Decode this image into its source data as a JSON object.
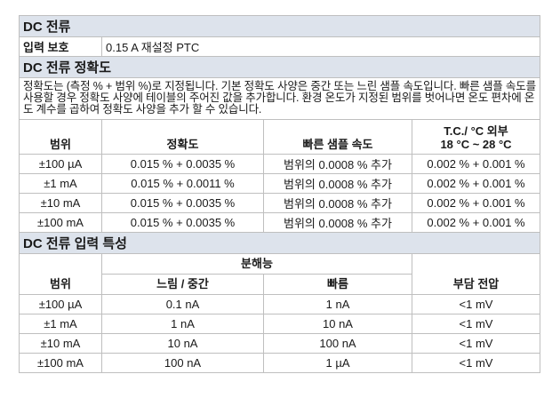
{
  "dc_current": {
    "title": "DC 전류",
    "input_protection_label": "입력 보호",
    "input_protection_value": "0.15 A 재설정 PTC"
  },
  "accuracy": {
    "title": "DC 전류 정확도",
    "description": "정확도는 (측정 % + 범위 %)로 지정됩니다. 기본 정확도 사양은 중간 또는 느린 샘플 속도입니다. 빠른 샘플 속도를 사용할 경우 정확도 사양에 테이블의 주어진 값을 추가합니다. 환경 온도가 지정된 범위를 벗어나면 온도 편차에 온도 계수를 곱하여 정확도 사양을 추가 할 수 있습니다.",
    "headers": {
      "range": "범위",
      "accuracy": "정확도",
      "fast_rate": "빠른 샘플 속도",
      "tc_line1": "T.C./ °C 외부",
      "tc_line2": "18 °C ~ 28 °C"
    },
    "rows": [
      {
        "range": "±100 µA",
        "accuracy": "0.015 % + 0.0035 %",
        "fast": "범위의 0.0008 % 추가",
        "tc": "0.002 % + 0.001 %"
      },
      {
        "range": "±1 mA",
        "accuracy": "0.015 % + 0.0011 %",
        "fast": "범위의 0.0008 % 추가",
        "tc": "0.002 % + 0.001 %"
      },
      {
        "range": "±10 mA",
        "accuracy": "0.015 % + 0.0035 %",
        "fast": "범위의 0.0008 % 추가",
        "tc": "0.002 % + 0.001 %"
      },
      {
        "range": "±100 mA",
        "accuracy": "0.015 % + 0.0035 %",
        "fast": "범위의 0.0008 % 추가",
        "tc": "0.002 % + 0.001 %"
      }
    ]
  },
  "input_char": {
    "title": "DC 전류 입력 특성",
    "headers": {
      "resolution": "분해능",
      "range": "범위",
      "slow_medium": "느림 / 중간",
      "fast": "빠름",
      "burden": "부담 전압"
    },
    "rows": [
      {
        "range": "±100 µA",
        "slow": "0.1 nA",
        "fast": "1 nA",
        "burden": "<1 mV"
      },
      {
        "range": "±1 mA",
        "slow": "1 nA",
        "fast": "10 nA",
        "burden": "<1 mV"
      },
      {
        "range": "±10 mA",
        "slow": "10 nA",
        "fast": "100 nA",
        "burden": "<1 mV"
      },
      {
        "range": "±100 mA",
        "slow": "100 nA",
        "fast": "1 µA",
        "burden": "<1 mV"
      }
    ]
  }
}
